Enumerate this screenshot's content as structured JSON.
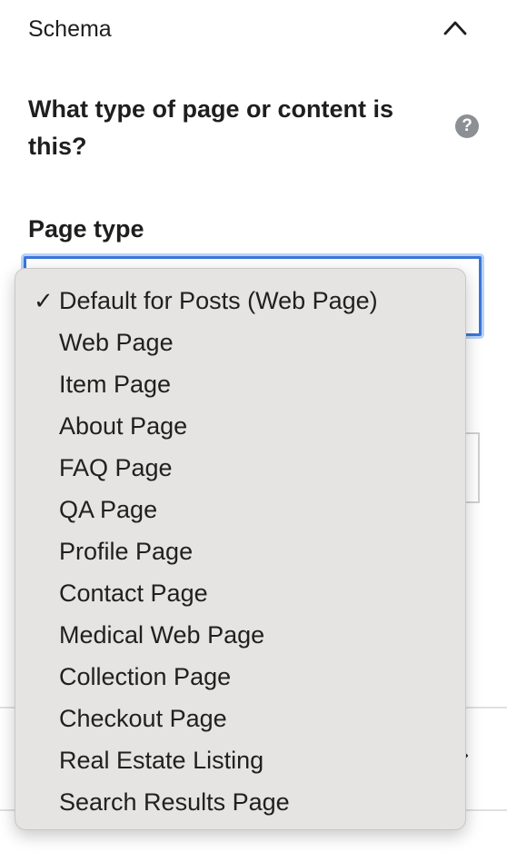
{
  "panel": {
    "title": "Schema",
    "toggle_icon": "chevron-up-icon"
  },
  "question": {
    "text": "What type of page or content is this?",
    "help_icon": "question-mark-icon",
    "help_glyph": "?"
  },
  "page_type": {
    "label": "Page type",
    "selected": "Default for Posts (Web Page)",
    "check_glyph": "✓",
    "options": [
      "Default for Posts (Web Page)",
      "Web Page",
      "Item Page",
      "About Page",
      "FAQ Page",
      "QA Page",
      "Profile Page",
      "Contact Page",
      "Medical Web Page",
      "Collection Page",
      "Checkout Page",
      "Real Estate Listing",
      "Search Results Page"
    ]
  },
  "colors": {
    "focus_border": "#3b76d9",
    "focus_ring": "#b9d2f7",
    "menu_background": "#e5e4e3",
    "text": "#1e1e1e",
    "help_icon_bg": "#8c8f94"
  }
}
